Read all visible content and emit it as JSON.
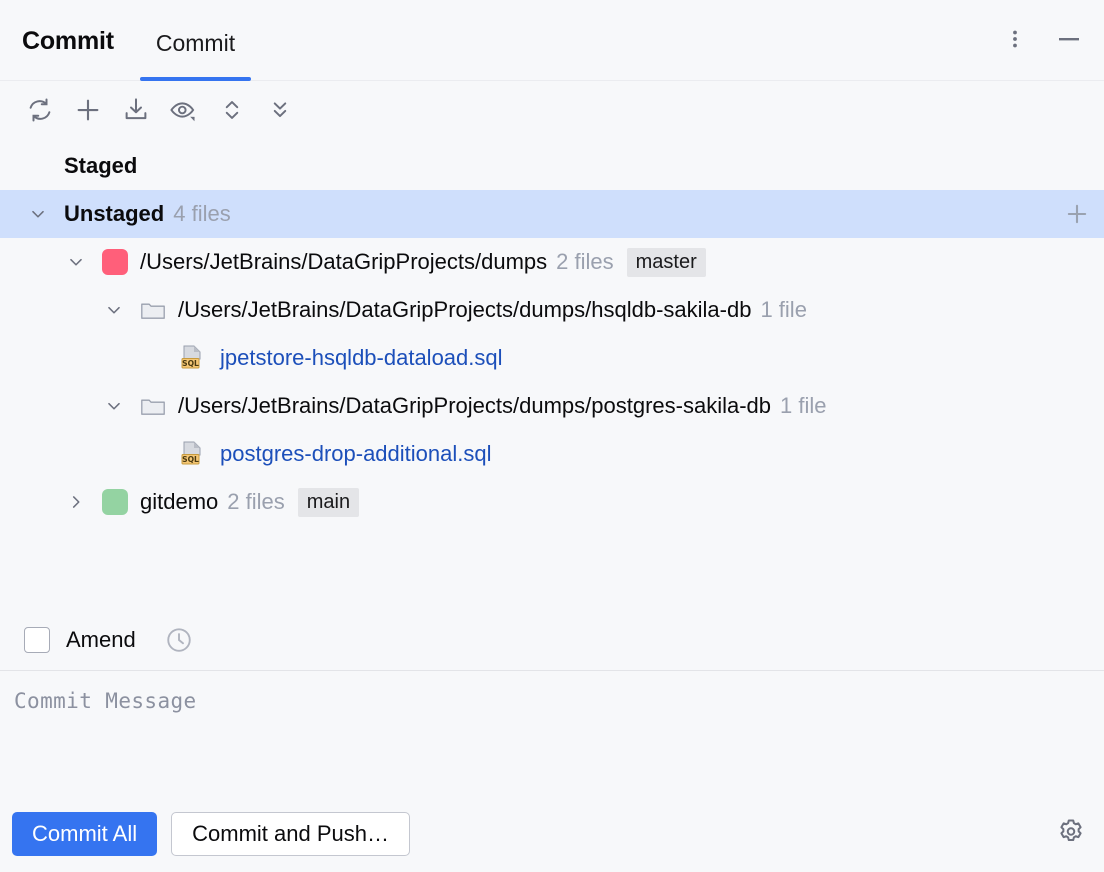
{
  "header": {
    "title": "Commit",
    "tabs": [
      {
        "label": "Commit",
        "active": true
      }
    ],
    "more_options_icon": "more-vertical-icon",
    "minimize_icon": "minimize-icon"
  },
  "toolbar": {
    "items": [
      {
        "name": "refresh-icon",
        "tooltip": "Refresh Changes"
      },
      {
        "name": "plus-icon",
        "tooltip": "Add"
      },
      {
        "name": "stash-icon",
        "tooltip": "Stash Changes"
      },
      {
        "name": "eye-icon",
        "tooltip": "Show Diff"
      },
      {
        "name": "expand-all-icon",
        "tooltip": "Expand All"
      },
      {
        "name": "collapse-all-icon",
        "tooltip": "Collapse All"
      }
    ]
  },
  "tree": {
    "rows": [
      {
        "id": "staged",
        "label": "Staged",
        "indent": 0,
        "style": "bold",
        "chevron": "none",
        "selected": false
      },
      {
        "id": "unstaged",
        "label": "Unstaged",
        "count": "4 files",
        "indent": 0,
        "style": "bold",
        "chevron": "down",
        "selected": true,
        "trailing_icon": "plus-icon"
      },
      {
        "id": "repo-dumps",
        "label": "/Users/JetBrains/DataGripProjects/dumps",
        "count": "2 files",
        "badge": "master",
        "indent": 1,
        "style": "normal",
        "chevron": "down",
        "icon": "repo-square",
        "icon_color": "#ff5f7a",
        "selected": false
      },
      {
        "id": "dir-hsqldb",
        "label": "/Users/JetBrains/DataGripProjects/dumps/hsqldb-sakila-db",
        "count": "1 file",
        "indent": 2,
        "style": "normal",
        "chevron": "down",
        "icon": "folder-icon",
        "selected": false
      },
      {
        "id": "file-jpetstore",
        "label": "jpetstore-hsqldb-dataload.sql",
        "indent": 3,
        "style": "link",
        "chevron": "none",
        "icon": "sql-file-icon",
        "selected": false
      },
      {
        "id": "dir-postgres",
        "label": "/Users/JetBrains/DataGripProjects/dumps/postgres-sakila-db",
        "count": "1 file",
        "indent": 2,
        "style": "normal",
        "chevron": "down",
        "icon": "folder-icon",
        "selected": false
      },
      {
        "id": "file-postgres-drop",
        "label": "postgres-drop-additional.sql",
        "indent": 3,
        "style": "link",
        "chevron": "none",
        "icon": "sql-file-icon",
        "selected": false
      },
      {
        "id": "repo-gitdemo",
        "label": "gitdemo",
        "count": "2 files",
        "badge": "main",
        "indent": 1,
        "style": "normal",
        "chevron": "right",
        "icon": "repo-square",
        "icon_color": "#94d3a2",
        "selected": false
      }
    ]
  },
  "amend": {
    "label": "Amend",
    "checked": false,
    "history_icon": "clock-icon"
  },
  "commit_message": {
    "value": "",
    "placeholder": "Commit Message"
  },
  "footer": {
    "commit_all_label": "Commit All",
    "commit_and_push_label": "Commit and Push…",
    "settings_icon": "gear-icon"
  },
  "colors": {
    "accent": "#3574f0",
    "selection": "#cfdffc",
    "background": "#f7f8fa",
    "link": "#1c4fba",
    "muted": "#9aa0ae",
    "badge_bg": "#e4e5e8"
  }
}
